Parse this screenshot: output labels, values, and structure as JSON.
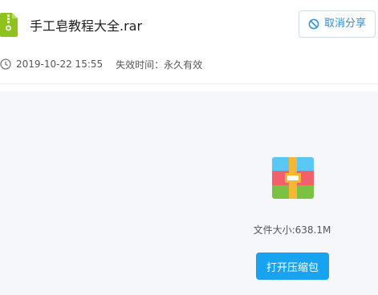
{
  "header": {
    "file_name": "手工皂教程大全.rar",
    "file_icon": "zip-file-icon",
    "cancel_share_label": "取消分享",
    "cancel_share_icon": "cancel-circle-icon"
  },
  "meta": {
    "date": "2019-10-22 15:55",
    "expiry_label": "失效时间：",
    "expiry_value": "永久有效",
    "clock_icon": "clock-icon"
  },
  "main": {
    "archive_icon": "archive-icon",
    "file_size": "文件大小:638.1M",
    "open_button_label": "打开压缩包"
  },
  "colors": {
    "accent": "#17a3f0",
    "link": "#2d8fd8",
    "file_icon_green": "#8dc21f",
    "panel_bg": "#f5f7fb"
  }
}
